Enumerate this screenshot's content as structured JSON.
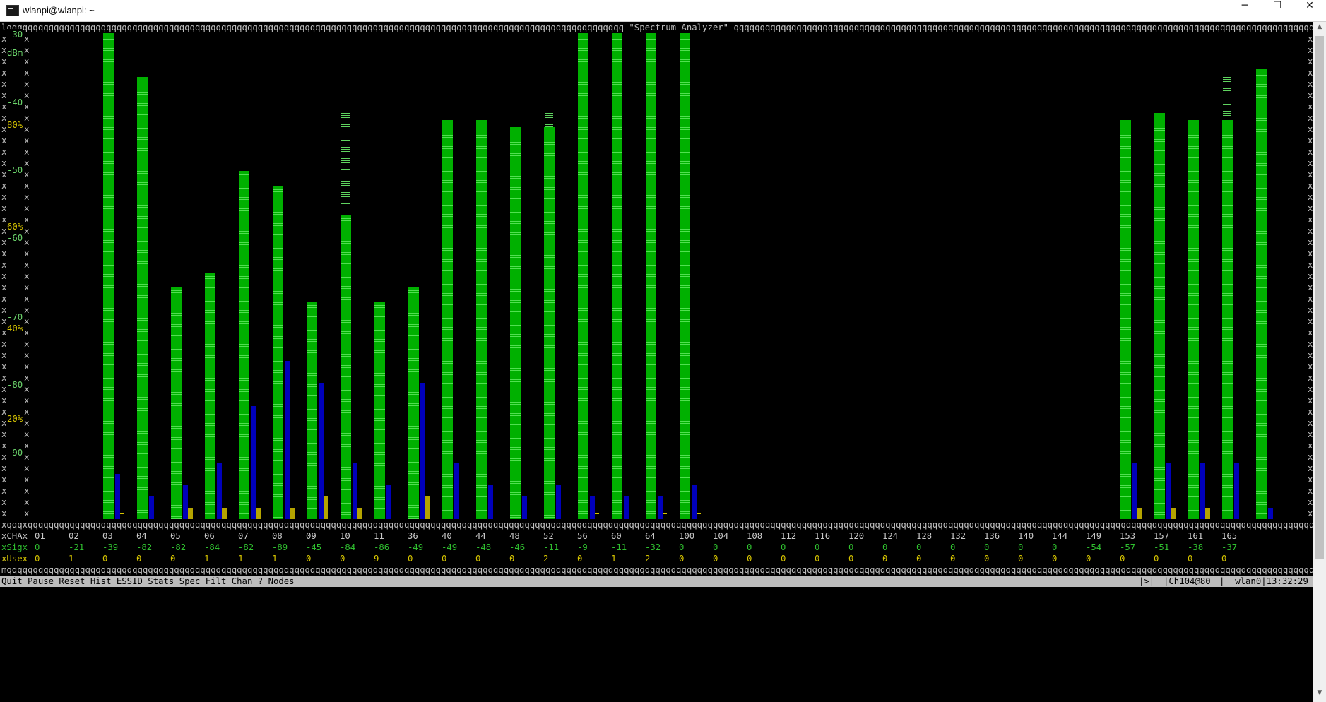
{
  "window": {
    "title": "wlanpi@wlanpi: ~",
    "minimize_glyph": "─",
    "maximize_glyph": "☐",
    "close_glyph": "✕"
  },
  "analyzer": {
    "top_border": "lqqqqqqqqqqqqqqqqqqqqqqqqqqqqqqqqqqqqqqqqqqqqqqqqqqqqqqqqqqqqqqqqqqqqqqqqqqqqqqqqqqqqqqqqqqqqqqqqqqqqqqqqqqqqqqqqqqqqqq \"Spectrum Analyzer\" qqqqqqqqqqqqqqqqqqqqqqqqqqqqqqqqqqqqqqqqqqqqqqqqqqqqqqqqqqqqqqqqqqqqqqqqqqqqqqqqqqqqqqqqqqqqqqqqqqqqqqqqqqqqqqqqqqqqqqk",
    "axis_dbm_labels": [
      "-30",
      "-40",
      "-50",
      "-60",
      "-70",
      "-80",
      "-90"
    ],
    "axis_unit": "dBm",
    "axis_pct_labels": [
      "80%",
      "60%",
      "40%",
      "20%"
    ],
    "separator_line": "xqqqxqqqqqqqqqqqqqqqqqqqqqqqqqqqqqqqqqqqqqqqqqqqqqqqqqqqqqqqqqqqqqqqqqqqqqqqqqqqqqqqqqqqqqqqqqqqqqqqqqqqqqqqqqqqqqqqqqqqqqqqqqqqqqqqqqqqqqqqqqqqqqqqqqqqqqqqqqqqqqqqqqqqqqqqqqqqqqqqqqqqqqqqqqqqqqqqqqqqqqqqqqqqqqqqqqqqqqqqqqqqqqqqqqqqqqqqqqqqqqqqqqqqqqqqqqx",
    "bottom_border": "mqqqqqqqqqqqqqqqqqqqqqqqqqqqqqqqqqqqqqqqqqqqqqqqqqqqqqqqqqqqqqqqqqqqqqqqqqqqqqqqqqqqqqqqqqqqqqqqqqqqqqqqqqqqqqqqqqqqqqqqqqqqqqqqqqqqqqqqqqqqqqqqqqqqqqqqqqqqqqqqqqqqqqqqqqqqqqqqqqqqqqqqqqqqqqqqqqqqqqqqqqqqqqqqqqqqqqqqqqqqqqqqqqqqqqqqqqqqqqqqqqqqqqqqqqqqqj",
    "row_labels": {
      "cha": "CHA",
      "sig": "Sig",
      "use": "Use"
    },
    "menu": "Quit Pause Reset Hist ESSID Stats Spec Filt Chan ? Nodes",
    "status_nav": "|>|",
    "status_channel": "|Ch104@80",
    "status_iface": "|  wlan0|13:32:29"
  },
  "chart_data": {
    "type": "bar",
    "title": "Spectrum Analyzer",
    "ylabel": "dBm",
    "ylim": [
      -97,
      -30
    ],
    "categories": [
      "01",
      "02",
      "03",
      "04",
      "05",
      "06",
      "07",
      "08",
      "09",
      "10",
      "11",
      "36",
      "40",
      "44",
      "48",
      "52",
      "56",
      "60",
      "64",
      "100",
      "104",
      "108",
      "112",
      "116",
      "120",
      "124",
      "128",
      "132",
      "136",
      "140",
      "144",
      "149",
      "153",
      "157",
      "161",
      "165"
    ],
    "series": [
      {
        "name": "Sig",
        "values": [
          0,
          -21,
          -39,
          -82,
          -82,
          -84,
          -82,
          -89,
          -45,
          -84,
          -86,
          -49,
          -49,
          -48,
          -46,
          -11,
          -9,
          -11,
          -32,
          0,
          0,
          0,
          0,
          0,
          0,
          0,
          0,
          0,
          0,
          0,
          0,
          -54,
          -57,
          -51,
          -38,
          -37
        ]
      },
      {
        "name": "Use",
        "values": [
          0,
          1,
          0,
          0,
          0,
          1,
          1,
          1,
          0,
          0,
          9,
          0,
          0,
          0,
          0,
          2,
          0,
          1,
          2,
          0,
          0,
          0,
          0,
          0,
          0,
          0,
          0,
          0,
          0,
          0,
          0,
          0,
          0,
          0,
          0,
          0
        ]
      }
    ],
    "bar_levels_dbm": [
      null,
      -30,
      -36,
      -65,
      -63,
      -49,
      -51,
      -67,
      -55,
      -67,
      -65,
      -42,
      -42,
      -43,
      -43,
      -30,
      -30,
      -30,
      -30,
      null,
      null,
      null,
      null,
      null,
      null,
      null,
      null,
      null,
      null,
      null,
      null,
      -42,
      -41,
      -42,
      -42,
      -35
    ],
    "history_levels_dbm": [
      null,
      null,
      null,
      null,
      null,
      null,
      null,
      null,
      -41,
      null,
      null,
      null,
      null,
      null,
      -41,
      null,
      null,
      null,
      null,
      null,
      null,
      null,
      null,
      null,
      null,
      null,
      null,
      null,
      null,
      null,
      null,
      null,
      null,
      null,
      -36,
      null
    ],
    "blue_levels_pct": [
      null,
      4,
      2,
      3,
      5,
      10,
      14,
      12,
      5,
      3,
      12,
      5,
      3,
      2,
      3,
      2,
      2,
      2,
      3,
      null,
      null,
      null,
      null,
      null,
      null,
      null,
      null,
      null,
      null,
      null,
      null,
      5,
      5,
      5,
      5,
      1
    ],
    "yellow_levels_pct": [
      null,
      0,
      0,
      1,
      1,
      1,
      1,
      2,
      1,
      0,
      2,
      0,
      0,
      0,
      0,
      0,
      0,
      0,
      0,
      null,
      null,
      null,
      null,
      null,
      null,
      null,
      null,
      null,
      null,
      null,
      null,
      1,
      1,
      1,
      0,
      0
    ]
  }
}
